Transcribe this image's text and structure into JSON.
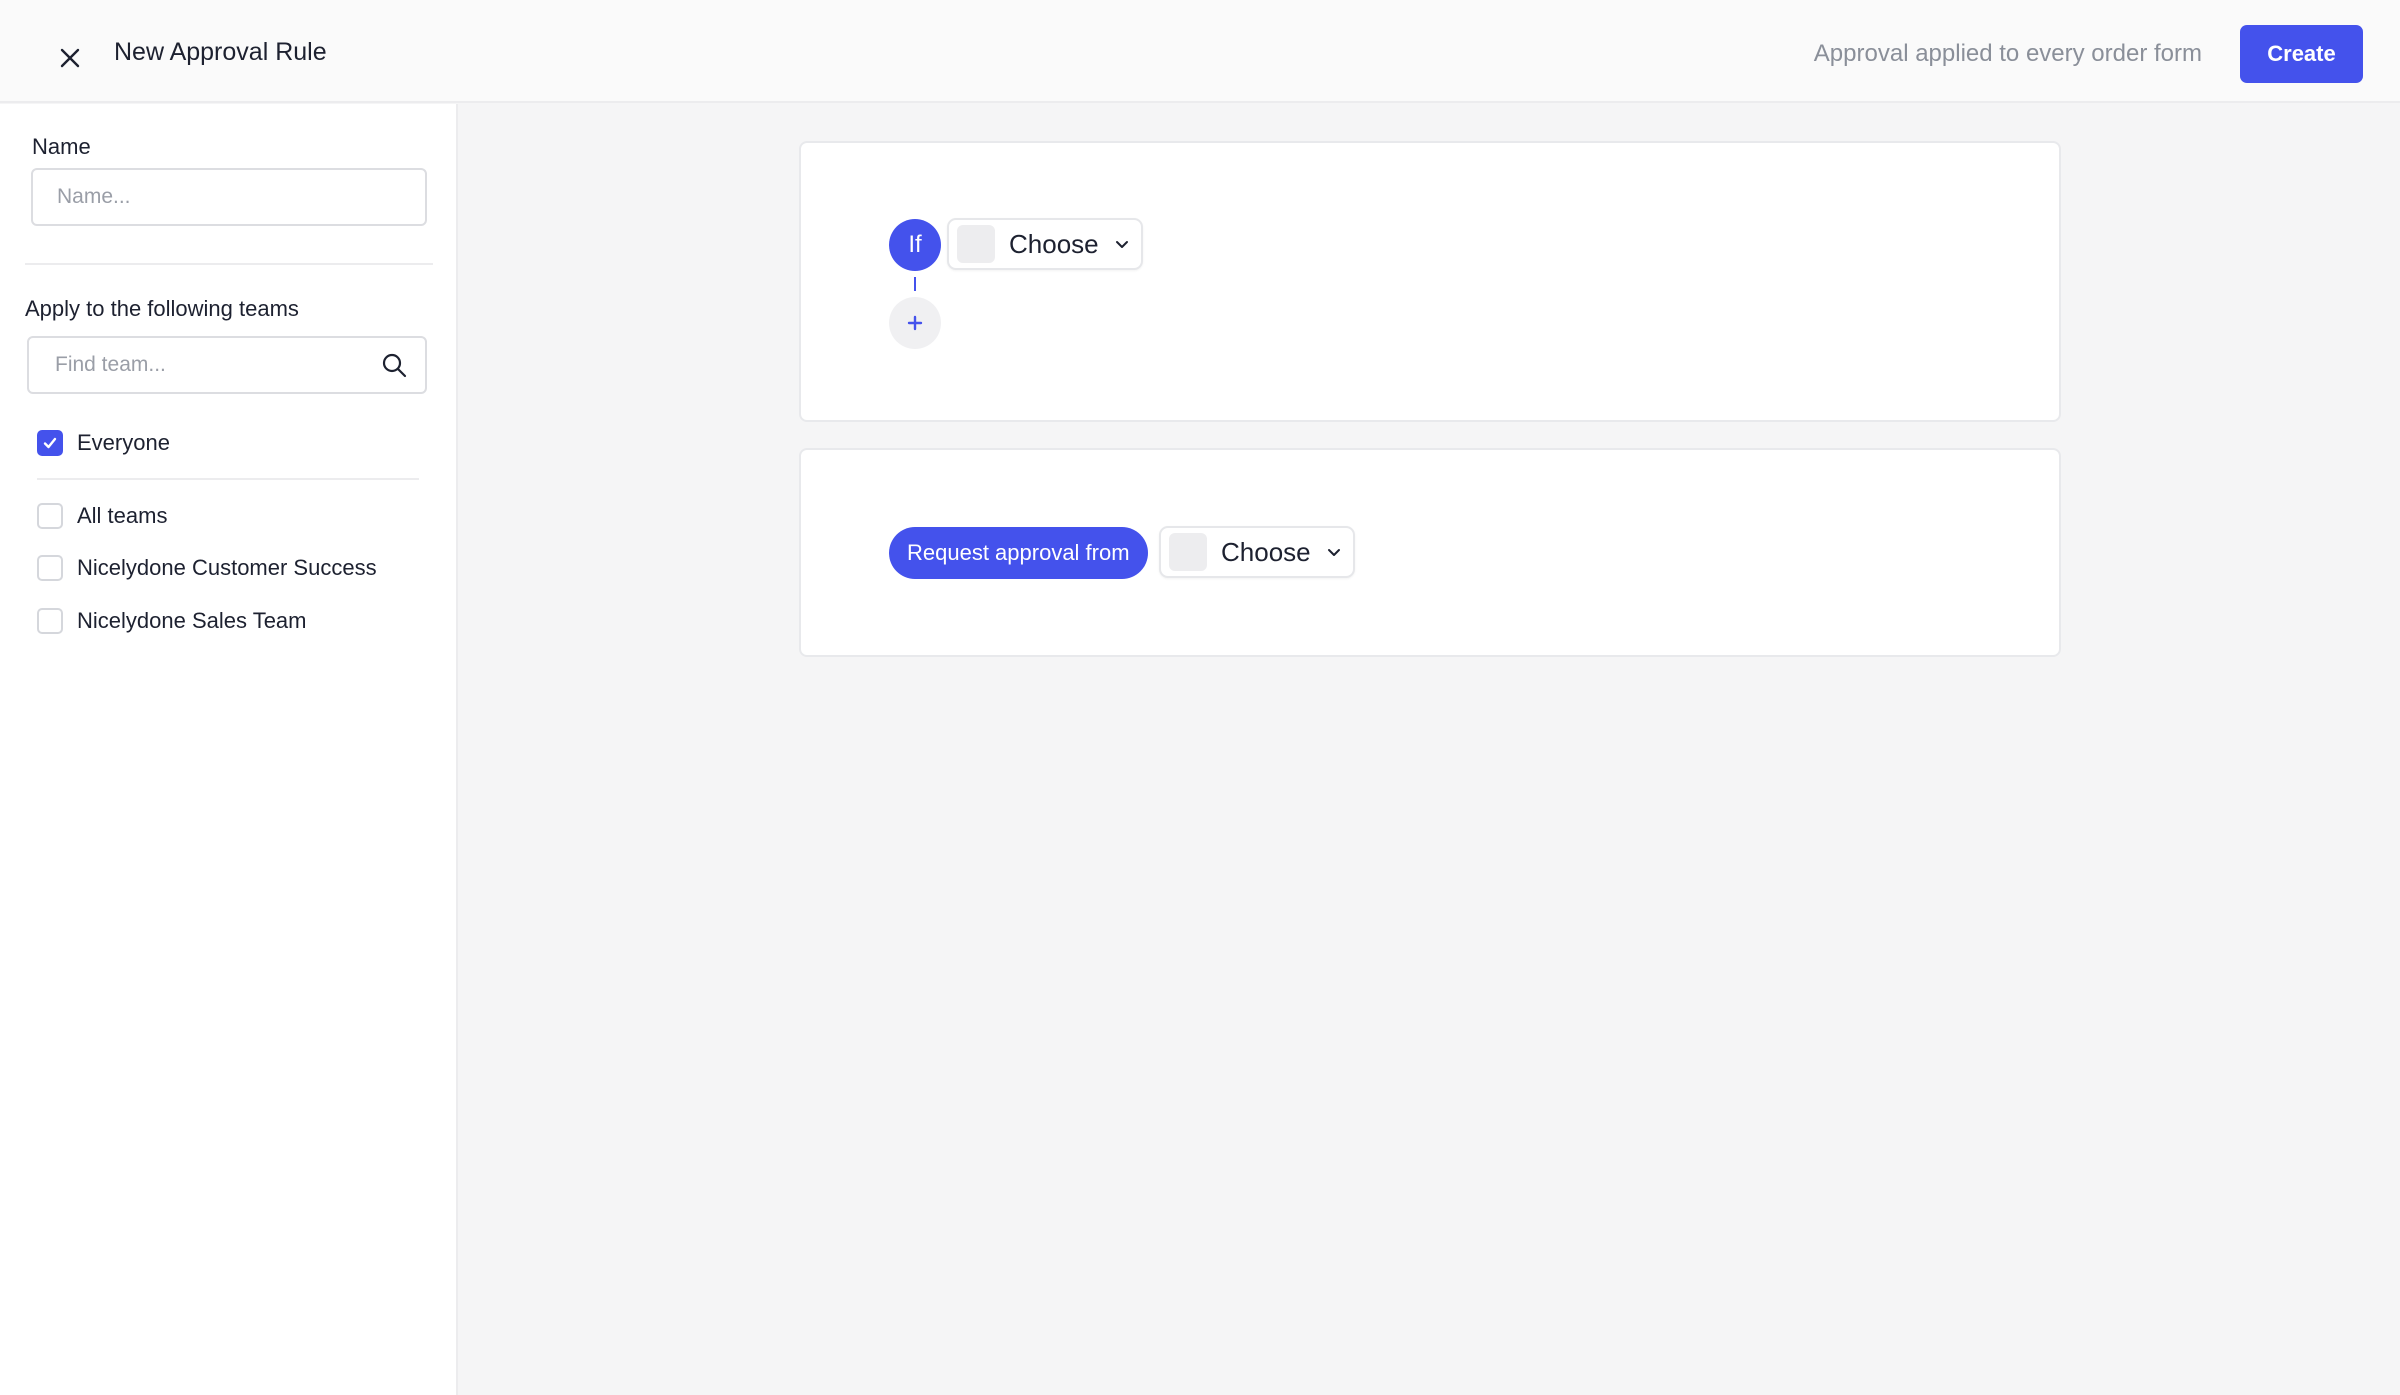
{
  "header": {
    "title": "New Approval Rule",
    "note": "Approval applied to every order form",
    "create_label": "Create"
  },
  "sidebar": {
    "name_label": "Name",
    "name_placeholder": "Name...",
    "name_value": "",
    "teams_label": "Apply to the following teams",
    "search_placeholder": "Find team...",
    "options": [
      {
        "label": "Everyone",
        "checked": true
      },
      {
        "label": "All teams",
        "checked": false
      },
      {
        "label": "Nicelydone Customer Success",
        "checked": false
      },
      {
        "label": "Nicelydone Sales Team",
        "checked": false
      }
    ]
  },
  "condition_card": {
    "if_label": "If",
    "choose_label": "Choose",
    "add_label": "+"
  },
  "approval_card": {
    "request_label": "Request approval from",
    "choose_label": "Choose"
  },
  "colors": {
    "accent": "#4452ec",
    "background": "#f5f5f6",
    "muted_text": "#8a8f99"
  },
  "icons": {
    "close": "close-icon",
    "search": "search-icon",
    "chevron": "chevron-down-icon",
    "check": "check-icon",
    "plus": "plus-icon"
  }
}
